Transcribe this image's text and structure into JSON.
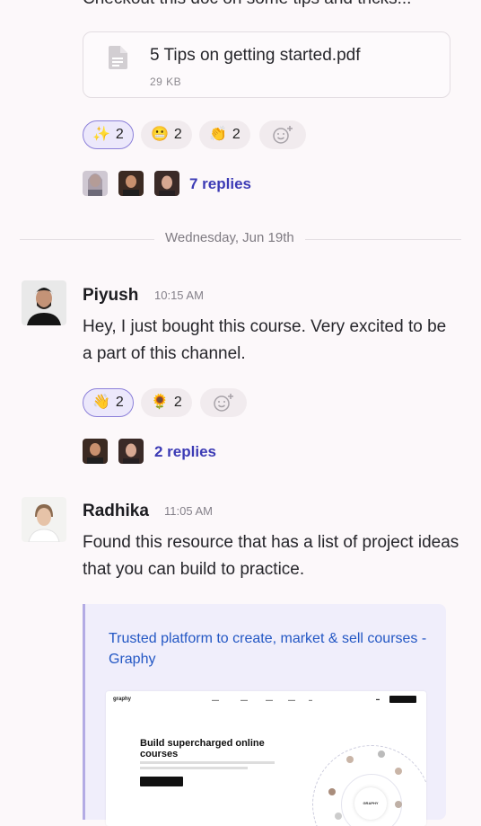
{
  "top_message": {
    "partial_text": "Checkout this doc on some tips and tricks..."
  },
  "attachment": {
    "file_name": "5 Tips on getting started.pdf",
    "file_size": "29 KB"
  },
  "message1": {
    "reactions": [
      {
        "emoji": "✨",
        "count": "2",
        "active": true
      },
      {
        "emoji": "😬",
        "count": "2",
        "active": false
      },
      {
        "emoji": "👏",
        "count": "2",
        "active": false
      }
    ],
    "replies_label": "7 replies"
  },
  "date_divider": "Wednesday, Jun 19th",
  "message2": {
    "author": "Piyush",
    "time": "10:15 AM",
    "text": "Hey, I just bought this course. Very excited to be a part of this channel.",
    "reactions": [
      {
        "emoji": "👋",
        "count": "2",
        "active": true
      },
      {
        "emoji": "🌻",
        "count": "2",
        "active": false
      }
    ],
    "replies_label": "2 replies"
  },
  "message3": {
    "author": "Radhika",
    "time": "11:05 AM",
    "text": "Found this resource that has a list of project ideas that you can build to practice.",
    "link_preview": {
      "title": "Trusted platform to create, market & sell courses - Graphy",
      "screenshot": {
        "logo": "graphy",
        "headline": "Build supercharged online courses",
        "center_label": "GRAPHY"
      }
    }
  },
  "colors": {
    "accent": "#3c3bb5",
    "link": "#2357c4",
    "active_reaction_border": "#8c80d9"
  }
}
